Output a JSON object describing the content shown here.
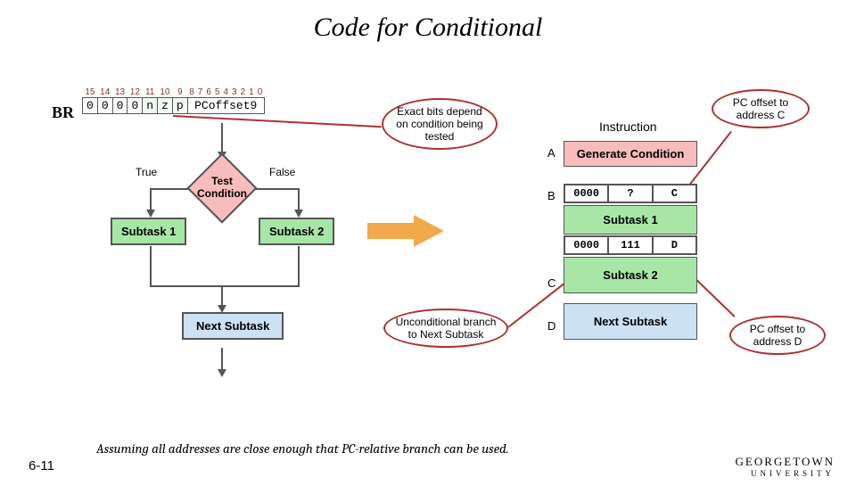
{
  "title": "Code for Conditional",
  "encoding": {
    "opcode": "BR",
    "headers": [
      "15",
      "14",
      "13",
      "12",
      "11",
      "10",
      "9",
      "8",
      "7",
      "6",
      "5",
      "4",
      "3",
      "2",
      "1",
      "0"
    ],
    "bits": [
      "0",
      "0",
      "0",
      "0",
      "n",
      "z",
      "p"
    ],
    "offset_label": "PCoffset9"
  },
  "flow": {
    "test": "Test Condition",
    "true": "True",
    "false": "False",
    "sub1": "Subtask 1",
    "sub2": "Subtask 2",
    "next": "Next Subtask"
  },
  "callouts": {
    "bits": "Exact bits depend on condition being tested",
    "pc_c": "PC offset to address C",
    "uncond": "Unconditional branch to Next Subtask",
    "pc_d": "PC offset to address D"
  },
  "column": {
    "header": "Instruction",
    "A": "A",
    "B": "B",
    "C": "C",
    "D": "D",
    "gen": "Generate Condition",
    "rowB": [
      "0000",
      "?",
      "C"
    ],
    "sub1": "Subtask 1",
    "rowMid": [
      "0000",
      "111",
      "D"
    ],
    "sub2": "Subtask 2",
    "next": "Next Subtask"
  },
  "footer": {
    "note": "Assuming all addresses are close enough that PC-relative branch can be used.",
    "num": "6-11",
    "uni1": "GEORGETOWN",
    "uni2": "UNIVERSITY"
  }
}
